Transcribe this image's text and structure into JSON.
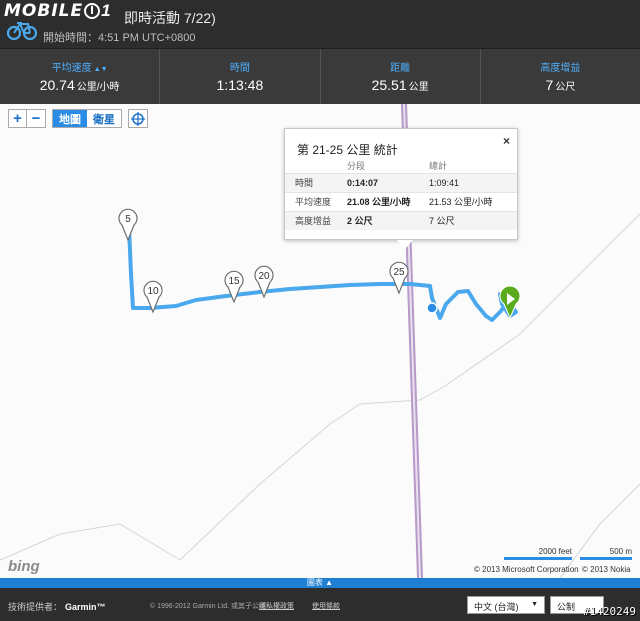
{
  "header": {
    "brand": "MOBILE",
    "brand_tail": "1",
    "title": "即時活動 7/22)",
    "subtitle": "開始時間：4:51 PM UTC+0800"
  },
  "stats": [
    {
      "label": "平均速度",
      "value": "20.74",
      "unit": "公里/小時"
    },
    {
      "label": "時間",
      "value": "1:13:48",
      "unit": ""
    },
    {
      "label": "距離",
      "value": "25.51",
      "unit": "公里"
    },
    {
      "label": "高度增益",
      "value": "7",
      "unit": "公尺"
    }
  ],
  "map": {
    "zoom_in": "+",
    "zoom_out": "−",
    "type_map": "地圖",
    "type_satellite": "衛星",
    "markers": [
      "5",
      "10",
      "15",
      "20",
      "25"
    ],
    "popup": {
      "title": "第 21-25 公里 統計",
      "close": "×",
      "col_segment": "分段",
      "col_total": "總計",
      "rows": [
        {
          "label": "時間",
          "segment": "0:14:07",
          "total": "1:09:41"
        },
        {
          "label": "平均速度",
          "segment": "21.08 公里/小時",
          "total": "21.53 公里/小時"
        },
        {
          "label": "高度增益",
          "segment": "2 公尺",
          "total": "7 公尺"
        }
      ]
    },
    "bing": "bing",
    "scale_ft": "2000 feet",
    "scale_m": "500 m",
    "copyright_ms": "© 2013 Microsoft Corporation",
    "copyright_nokia": "© 2013 Nokia",
    "route_color": "#4aa8ec",
    "start_color": "#5aaa1e"
  },
  "chartbar": {
    "label": "圖表 ▲"
  },
  "footer": {
    "provided_by": "技術提供者：",
    "garmin": "Garmin™",
    "copyright": "© 1996-2012 Garmin Ltd. 或其子公司",
    "link1": "隱私權政策",
    "link2": "使用條款",
    "language": "中文 (台灣)",
    "units": "公制",
    "watermark": "#1420249"
  }
}
